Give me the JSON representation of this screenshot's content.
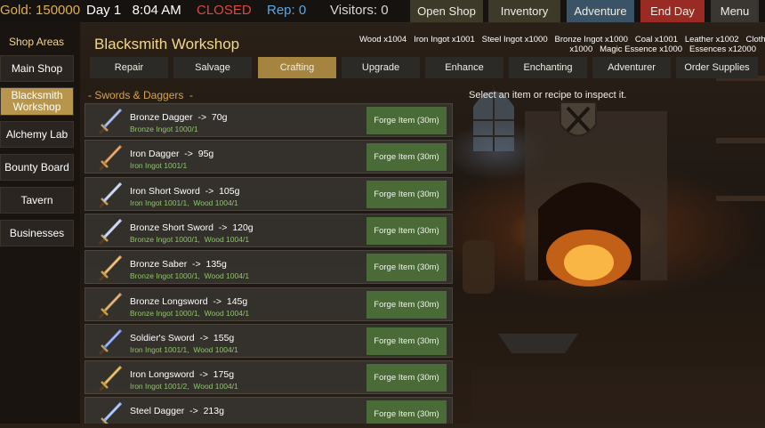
{
  "topbar": {
    "gold": "Gold: 150000",
    "day_time": "Day 1   8:04 AM",
    "status": "CLOSED",
    "rep": "Rep: 0",
    "visitors": "Visitors: 0",
    "buttons": {
      "open_shop": "Open Shop",
      "inventory": "Inventory",
      "adventure": "Adventure",
      "end_day": "End Day",
      "menu": "Menu"
    }
  },
  "sidebar": {
    "title": "Shop Areas",
    "items": [
      {
        "label": "Main Shop"
      },
      {
        "label": "Blacksmith Workshop",
        "active": true
      },
      {
        "label": "Alchemy Lab"
      },
      {
        "label": "Bounty Board"
      },
      {
        "label": "Tavern"
      },
      {
        "label": "Businesses"
      }
    ]
  },
  "panel": {
    "title": "Blacksmith Workshop",
    "resources_line1": "Wood x1004   Iron Ingot x1001   Steel Ingot x1000   Bronze Ingot x1000   Coal x1001   Leather x1002   Cloth",
    "resources_line2": "x1000   Magic Essence x1000   Essences x12000",
    "tabs": [
      "Repair",
      "Salvage",
      "Crafting",
      "Upgrade",
      "Enhance",
      "Enchanting",
      "Adventurer",
      "Order Supplies"
    ],
    "active_tab": "Crafting",
    "category": "- Swords & Daggers  -",
    "inspect_hint": "Select an item or recipe to inspect it."
  },
  "recipes": [
    {
      "name": "Bronze Dagger  ->  70g",
      "cost": "Bronze Ingot 1000/1",
      "icon": "bronze-dagger-icon",
      "forge": "Forge Item (30m)"
    },
    {
      "name": "Iron Dagger  ->  95g",
      "cost": "Iron Ingot 1001/1",
      "icon": "iron-dagger-icon",
      "forge": "Forge Item (30m)"
    },
    {
      "name": "Iron Short Sword  ->  105g",
      "cost": "Iron Ingot 1001/1,  Wood 1004/1",
      "icon": "iron-short-sword-icon",
      "forge": "Forge Item (30m)"
    },
    {
      "name": "Bronze Short Sword  ->  120g",
      "cost": "Bronze Ingot 1000/1,  Wood 1004/1",
      "icon": "bronze-short-sword-icon",
      "forge": "Forge Item (30m)"
    },
    {
      "name": "Bronze Saber  ->  135g",
      "cost": "Bronze Ingot 1000/1,  Wood 1004/1",
      "icon": "bronze-saber-icon",
      "forge": "Forge Item (30m)"
    },
    {
      "name": "Bronze Longsword  ->  145g",
      "cost": "Bronze Ingot 1000/1,  Wood 1004/1",
      "icon": "bronze-longsword-icon",
      "forge": "Forge Item (30m)"
    },
    {
      "name": "Soldier's Sword  ->  155g",
      "cost": "Iron Ingot 1001/1,  Wood 1004/1",
      "icon": "soldiers-sword-icon",
      "forge": "Forge Item (30m)"
    },
    {
      "name": "Iron Longsword  ->  175g",
      "cost": "Iron Ingot 1001/2,  Wood 1004/1",
      "icon": "iron-longsword-icon",
      "forge": "Forge Item (30m)"
    },
    {
      "name": "Steel Dagger  ->  213g",
      "cost": "",
      "icon": "steel-dagger-icon",
      "forge": "Forge Item (30m)"
    }
  ],
  "colors": {
    "gold": "#e0b04a",
    "closed": "#e0483e",
    "rep": "#5aa8e8",
    "accent_tab": "#a5843f",
    "forge_button": "#4a6a37",
    "ingredient_ok": "#8ec46a"
  }
}
